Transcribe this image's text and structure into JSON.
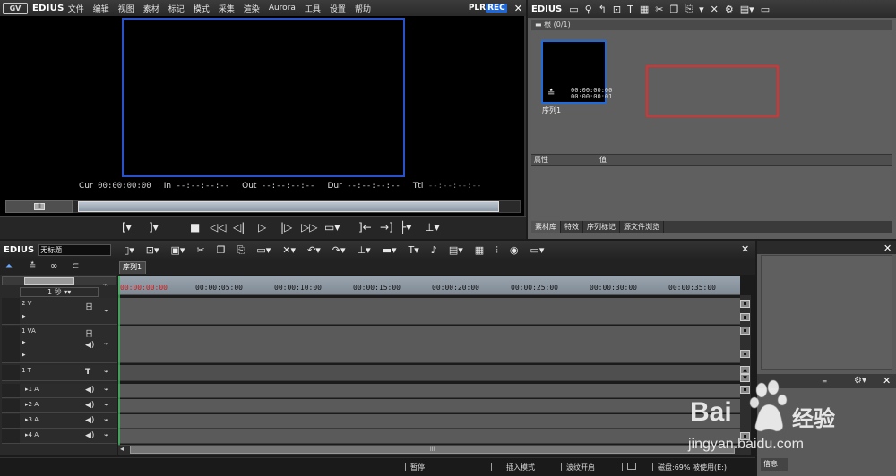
{
  "player": {
    "logo_short": "GV",
    "logo_text": "EDIUS",
    "menu": [
      "文件",
      "编辑",
      "视图",
      "素材",
      "标记",
      "模式",
      "采集",
      "渲染",
      "Aurora",
      "工具",
      "设置",
      "帮助"
    ],
    "plr_label": "PLR",
    "rec_label": "REC",
    "timecodes": [
      {
        "label": "Cur",
        "value": "00:00:00:00"
      },
      {
        "label": "In",
        "value": "--:--:--:--"
      },
      {
        "label": "Out",
        "value": "--:--:--:--"
      },
      {
        "label": "Dur",
        "value": "--:--:--:--"
      },
      {
        "label": "Ttl",
        "value": "--:--:--:--"
      }
    ],
    "scrub_knob": "II"
  },
  "bin": {
    "title": "EDIUS",
    "path": "根 (0/1)",
    "clip_name": "序列1",
    "clip_tc_in": "00:00:00:00",
    "clip_tc_out": "00:00:00:01",
    "prop_col1": "属性",
    "prop_col2": "值",
    "tabs": [
      "素材库",
      "特效",
      "序列标记",
      "源文件浏览"
    ]
  },
  "timeline": {
    "logo": "EDIUS",
    "project_name": "无标题",
    "sequence_tab": "序列1",
    "scale": "1 秒",
    "ruler": [
      "00:00:00:00",
      "00:00:05:00",
      "00:00:10:00",
      "00:00:15:00",
      "00:00:20:00",
      "00:00:25:00",
      "00:00:30:00",
      "00:00:35:00"
    ],
    "tracks": [
      {
        "name": "2 V"
      },
      {
        "name": "1 VA"
      },
      {
        "name": "1 T"
      },
      {
        "name": "1 A"
      },
      {
        "name": "2 A"
      },
      {
        "name": "3 A"
      },
      {
        "name": "4 A"
      }
    ],
    "scroll_thumb": "III"
  },
  "status": {
    "pause": "暂停",
    "insert_mode": "插入模式",
    "ripple": "波纹开启",
    "disk": "磁盘:69% 被使用(E:)"
  },
  "right_panel": {
    "tab": "信息"
  },
  "watermark": {
    "brand": "Bai",
    "brand_cn": "经验",
    "url": "jingyan.baidu.com"
  }
}
